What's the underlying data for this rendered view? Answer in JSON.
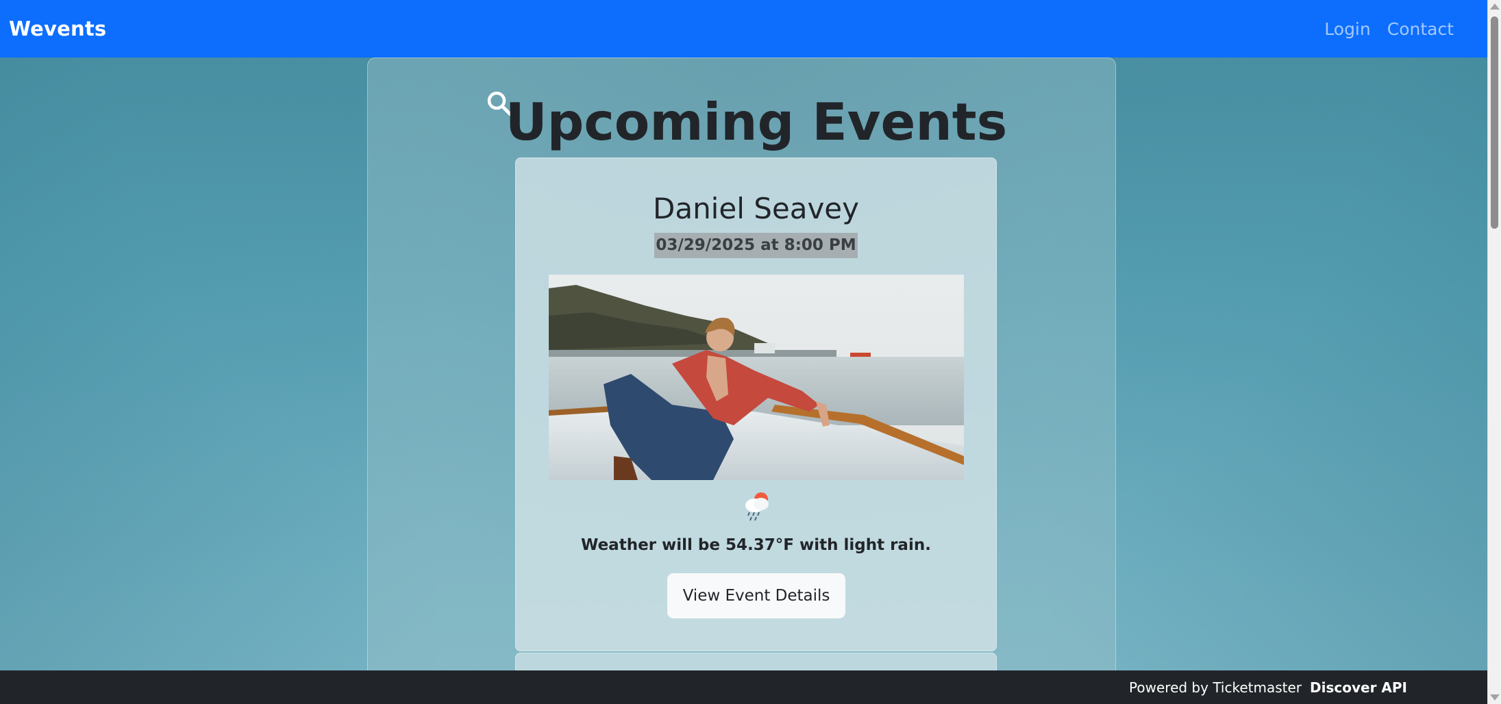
{
  "app": {
    "brand": "Wevents"
  },
  "nav": {
    "items": [
      {
        "label": "Login"
      },
      {
        "label": "Contact"
      }
    ]
  },
  "main": {
    "title": "Upcoming Events",
    "search_icon": "search-icon",
    "events": [
      {
        "name": "Daniel Seavey",
        "datetime": "03/29/2025 at 8:00 PM",
        "image_icon": "event-photo",
        "weather": {
          "icon": "light-rain-icon",
          "text": "Weather will be 54.37°F with light rain."
        },
        "details_label": "View Event Details"
      }
    ]
  },
  "footer": {
    "text": "Powered by Ticketmaster",
    "link": "Discover API"
  },
  "colors": {
    "navbar": "#0d6efd",
    "footer": "#212529",
    "text": "#212529",
    "background": "#5aa3b7"
  }
}
